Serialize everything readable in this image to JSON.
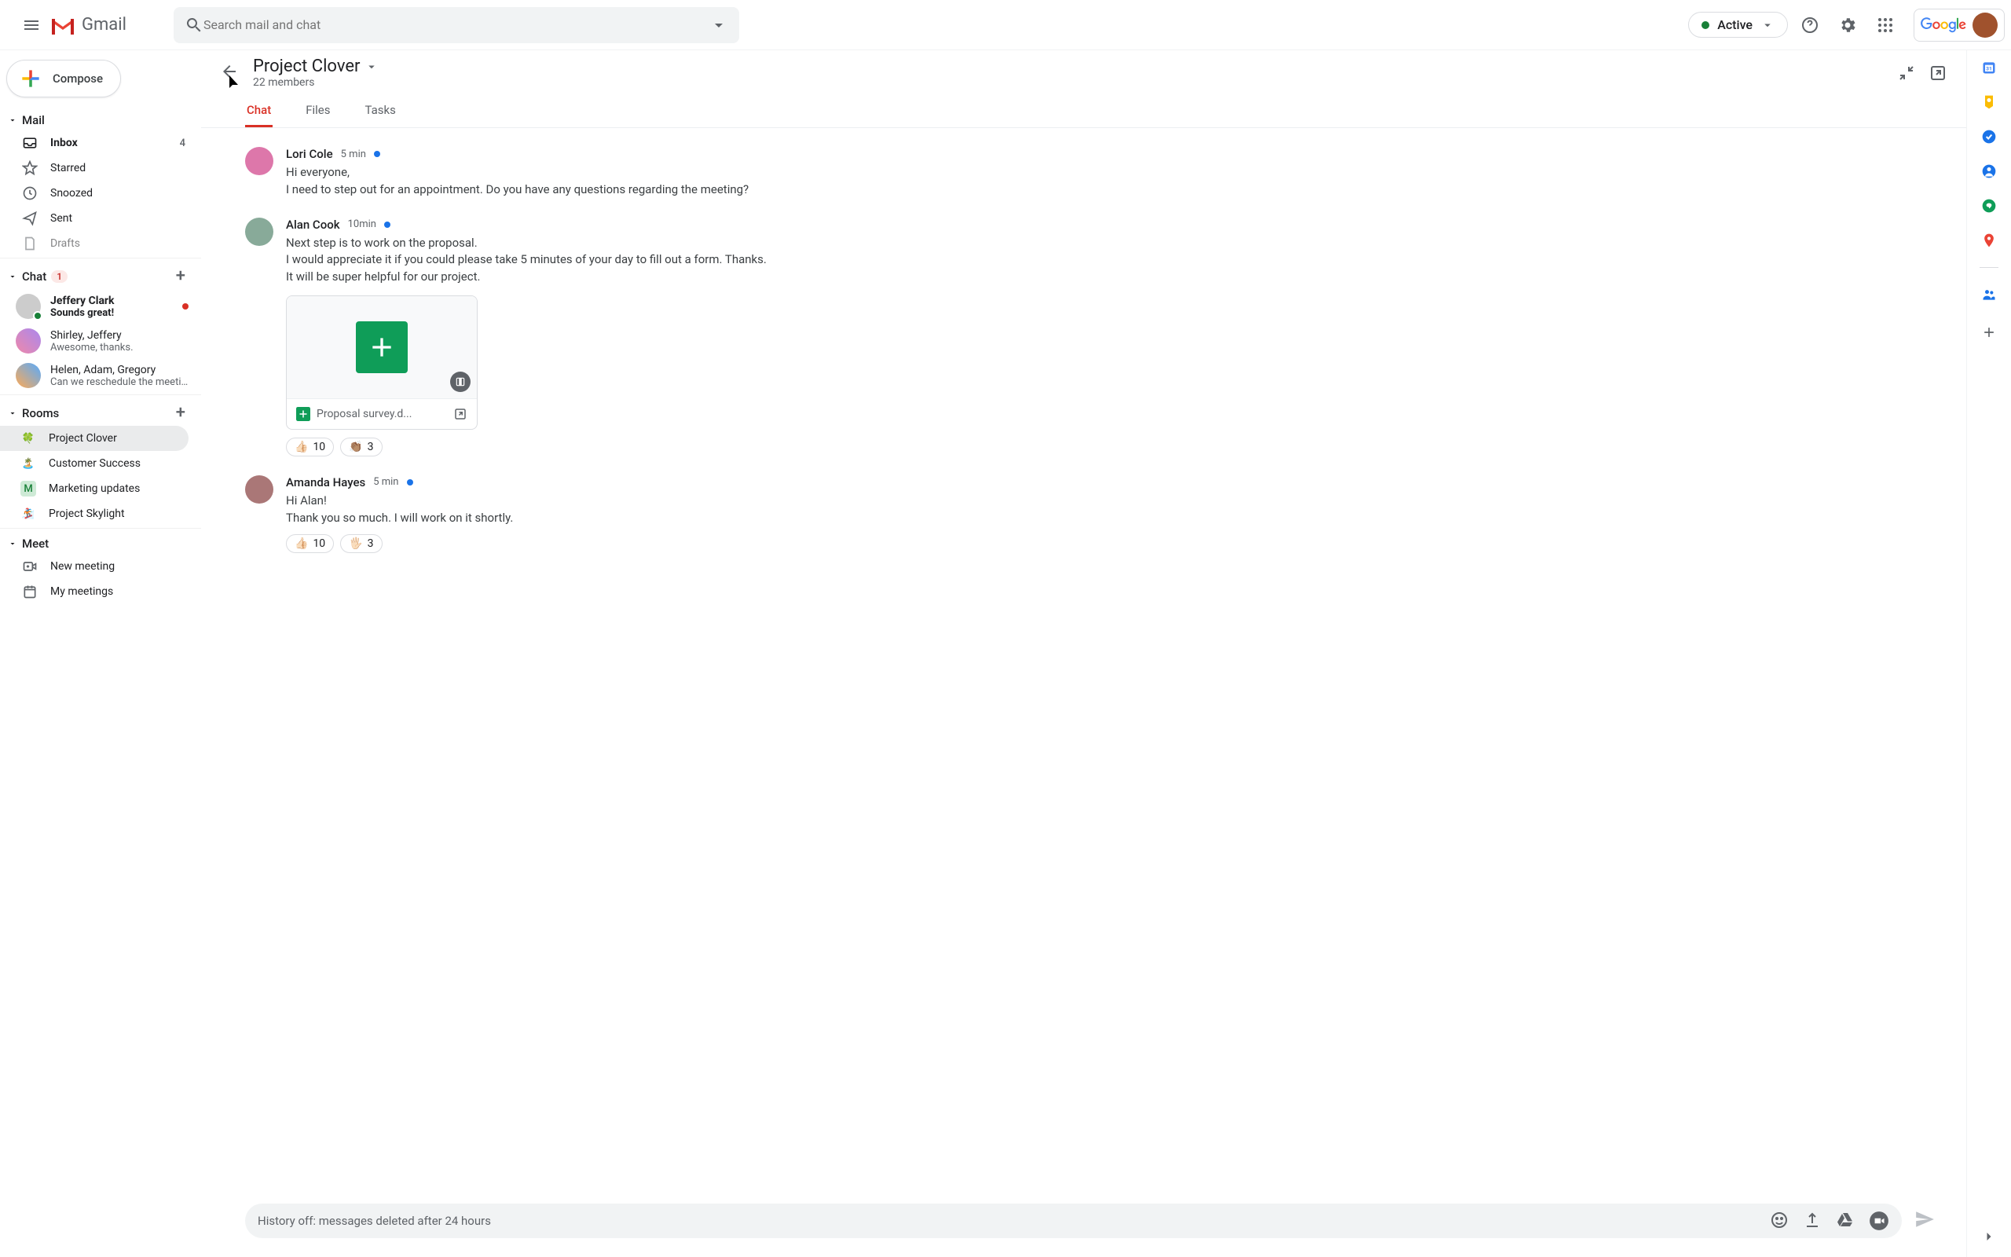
{
  "header": {
    "app_name": "Gmail",
    "search_placeholder": "Search mail and chat",
    "status_label": "Active"
  },
  "compose_label": "Compose",
  "sidebar": {
    "mail_label": "Mail",
    "mail_items": [
      {
        "label": "Inbox",
        "count": "4"
      },
      {
        "label": "Starred"
      },
      {
        "label": "Snoozed"
      },
      {
        "label": "Sent"
      },
      {
        "label": "Drafts"
      }
    ],
    "chat_label": "Chat",
    "chat_badge": "1",
    "chat_items": [
      {
        "name": "Jeffery Clark",
        "sub": "Sounds great!",
        "bold": true,
        "unread": true,
        "presence": true
      },
      {
        "name": "Shirley, Jeffery",
        "sub": "Awesome, thanks."
      },
      {
        "name": "Helen, Adam, Gregory",
        "sub": "Can we reschedule the meeti..."
      }
    ],
    "rooms_label": "Rooms",
    "rooms": [
      {
        "name": "Project Clover",
        "active": true,
        "icon": "🍀"
      },
      {
        "name": "Customer Success",
        "icon": "🏝️"
      },
      {
        "name": "Marketing updates",
        "letter": "M"
      },
      {
        "name": "Project Skylight",
        "icon": "🏂"
      }
    ],
    "meet_label": "Meet",
    "meet_items": [
      {
        "label": "New meeting"
      },
      {
        "label": "My meetings"
      }
    ]
  },
  "conversation": {
    "title": "Project Clover",
    "subtitle": "22 members",
    "tabs": [
      {
        "label": "Chat",
        "active": true
      },
      {
        "label": "Files"
      },
      {
        "label": "Tasks"
      }
    ],
    "messages": [
      {
        "author": "Lori Cole",
        "time": "5 min",
        "lines": [
          "Hi everyone,",
          "I need to step out for an appointment. Do you have any questions regarding the meeting?"
        ]
      },
      {
        "author": "Alan Cook",
        "time": "10min",
        "lines": [
          "Next step is to work on the proposal.",
          "I would appreciate it if you could please take 5 minutes of your day to fill out a form. Thanks.",
          "It will be super helpful for our project."
        ],
        "attachment": {
          "name": "Proposal survey.d..."
        },
        "reactions": [
          {
            "emoji": "👍🏻",
            "count": "10"
          },
          {
            "emoji": "👏🏽",
            "count": "3"
          }
        ]
      },
      {
        "author": "Amanda Hayes",
        "time": "5 min",
        "lines": [
          "Hi Alan!",
          "Thank you so much. I will work on it shortly."
        ],
        "reactions": [
          {
            "emoji": "👍🏻",
            "count": "10"
          },
          {
            "emoji": "🖐🏻",
            "count": "3"
          }
        ]
      }
    ],
    "composer_placeholder": "History off: messages deleted after 24 hours"
  }
}
